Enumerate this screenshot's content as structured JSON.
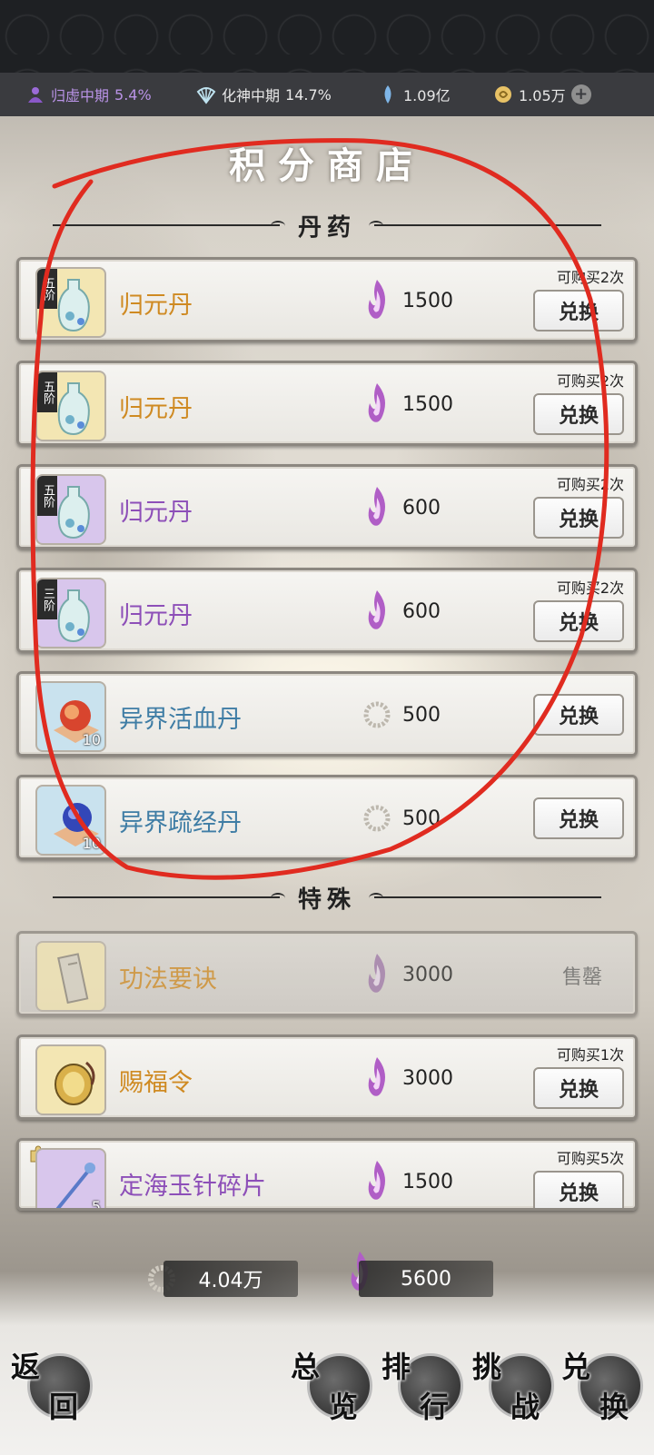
{
  "resources": [
    {
      "icon": "cultivation-stage-icon",
      "label": "归虚中期",
      "value": "5.4%"
    },
    {
      "icon": "fan-icon",
      "label": "化神中期",
      "value": "14.7%"
    },
    {
      "icon": "spirit-crystal-icon",
      "value": "1.09亿"
    },
    {
      "icon": "gold-coin-icon",
      "value": "1.05万"
    }
  ],
  "page_title": "积分商店",
  "sections": {
    "pills": "丹药",
    "special": "特殊"
  },
  "colors": {
    "gold": "#cf8a22",
    "purple": "#8d4fb8",
    "blue": "#3f7da5",
    "annotation_red": "#e02b20"
  },
  "items": [
    {
      "tier": "五阶",
      "name": "归元丹",
      "rarity": "gold",
      "currency": "purple-flame-icon",
      "price": "1500",
      "limit": "可购买2次",
      "button": "兑换"
    },
    {
      "tier": "五阶",
      "name": "归元丹",
      "rarity": "gold",
      "currency": "purple-flame-icon",
      "price": "1500",
      "limit": "可购买2次",
      "button": "兑换"
    },
    {
      "tier": "五阶",
      "name": "归元丹",
      "rarity": "purple",
      "currency": "purple-flame-icon",
      "price": "600",
      "limit": "可购买2次",
      "button": "兑换"
    },
    {
      "tier": "三阶",
      "name": "归元丹",
      "rarity": "purple",
      "currency": "purple-flame-icon",
      "price": "600",
      "limit": "可购买2次",
      "button": "兑换"
    },
    {
      "count": "10",
      "name": "异界活血丹",
      "rarity": "blue",
      "currency": "silver-coin-icon",
      "price": "500",
      "button": "兑换"
    },
    {
      "count": "10",
      "name": "异界疏经丹",
      "rarity": "blue",
      "currency": "silver-coin-icon",
      "price": "500",
      "button": "兑换"
    },
    {
      "name": "功法要诀",
      "rarity": "gold",
      "currency": "purple-flame-icon",
      "price": "3000",
      "status": "售罄"
    },
    {
      "name": "赐福令",
      "rarity": "gold",
      "currency": "purple-flame-icon",
      "price": "3000",
      "limit": "可购买1次",
      "button": "兑换"
    },
    {
      "count": "5",
      "name": "定海玉针碎片",
      "rarity": "purple",
      "currency": "purple-flame-icon",
      "price": "1500",
      "limit": "可购买5次",
      "button": "兑换"
    }
  ],
  "balances": [
    {
      "icon": "silver-coin-icon",
      "value": "4.04万"
    },
    {
      "icon": "purple-flame-icon",
      "value": "5600"
    }
  ],
  "nav": [
    {
      "c1": "返",
      "c2": "回"
    },
    {
      "c1": "总",
      "c2": "览"
    },
    {
      "c1": "排",
      "c2": "行"
    },
    {
      "c1": "挑",
      "c2": "战"
    },
    {
      "c1": "兑",
      "c2": "换"
    }
  ]
}
